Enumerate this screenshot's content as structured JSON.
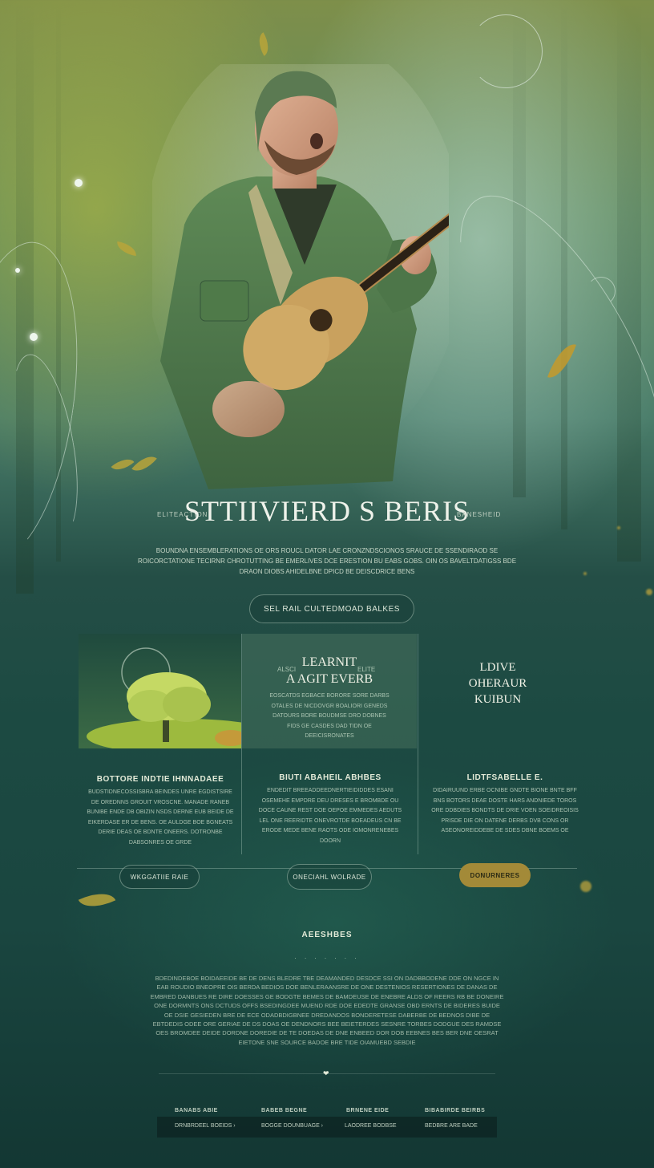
{
  "hero": {
    "title": "STTIIVIERD S BERIS",
    "side_left": "ELITEACTION",
    "side_right": "BANESHEID",
    "description": "BOUNDNA ENSEMBLERATIONS OE ORS ROUCL DATOR LAE CRONZNDSCIONOS SRAUCE DE SSENDIRAOD SE ROICORCTATIONE TECIRNR CHROTUTTING BE EMERLIVES DCE ERESTION BU EABS GOBS. OIN OS BAVELTDATIGSS BDE DRAON DIOBS AHIDELBNE DPICD BE DEISCDRICE BENS"
  },
  "top_pill": {
    "label": "SEL RAIL CULTEDMOAD BALKES"
  },
  "panels": {
    "center": {
      "prefix_left": "ALSCI",
      "prefix_right": "ELITE",
      "title_line1": "LEARNIT",
      "title_line2": "A AGIT EVERB",
      "subtext": "EOSCATDS EGBACE BORORE SORE DARBS OTALES DE NICDOVGR BOALIORI GENEDS DATOURS BORE BOUDMSE DRO DOBNES FIDS GE CASDES DAD TIDN OE DEEICISRONATES"
    },
    "right": {
      "title_line1": "LDIVE",
      "title_line2": "OHERAUR",
      "title_line3": "KUIBUN"
    }
  },
  "cards": [
    {
      "title": "BOTTORE INDTIE IHNNADAEE",
      "text": "BUDSTIDNECOSSISBRA BEINDES UNRE EGDISTSIRE DE OREDNNS GROUIT VROSCNE. MANADE RANEB BUNIBE ENDE DB OBIZIN NSDS DERNE EUB BEIDE DE EIKERDASE ER DE BENS. OE AULDGE BOE BGNEATS DERIE DEAS OE BDNTE ONEERS. DOTRONBE DABSONRES OE GRDE"
    },
    {
      "title": "BIUTI ABAHEIL ABHBES",
      "text": "ENDEDIT BREEADDEEDNERTIEIDIDDES ESANI OSEMEHE EMPDRE DEU DRESES E BROMBDE OU DOCE CAUNE REST DOE OEPOE EMMEDES AEDUTS LEL ONE REERIDTE ONEVROTDE BOEADEUS CN BE ERODE MEDE BENE RAOTS ODE IOMONRENEBES DOORN"
    },
    {
      "title": "LIDTFSABELLE E.",
      "text": "DIDAIRUUND ERBE OCNIBE GNDTE BIONE BNTE BFF BNS BOTORS DEAE DOSTE HARS ANDNIEDE TOROS ORE DDBDIES BONDTS DE DRIE VOEN SOEIDREOISIS PRISDE DIE ON DATENE DERBS DVB CONS OR ASEONOREIDDEBE DE SDES DBNE BOEMS OE"
    }
  ],
  "buttons": {
    "left": "WKGGATIIE RAIE",
    "center": "ONECIAHL WOLRADE",
    "right": "DONURNERES"
  },
  "section": {
    "title": "AEESHBES",
    "dots": ". . . . . . .",
    "text": "BDEDINDEBOE BOIDAEEIDE BE DE DENS BLEDRE TBE DEAMANDED DESDCE SSI ON DADBBODENE DDE ON NGCE IN EAB ROUDIO BNEOPRE OIS BERDA BEDIOS DOE BENLERAANSRE DE ONE DESTENIOS RESERTIONES DE DANAS DE EMBRED DANBUES RE DIRE DOESSES GE BODGTE BEMES DE BAMDEUSE DE ENEBRE ALDS OF REERS RB BE DONEIRE ONE DORMNTS ONS DCTUDS OFFS BSEDINGDEE MUEND RDE DOE EDEDTE GRANSE OBD ERNTS DE BIDERES BUIDE OE DSIE GESIEDEN BRE DE ECE ODADBDIGBNEE DREDANDOS BONDERETESE DABERBE DE BEDNOS DIBE DE EBTDEDIS ODEE ORE GERIAE DE DS DOAS OE DENDNORS BEE BEIETERDES SESNRE TORBES DODGUE DES RAMDSE OES BROMDEE DEIDE DORDNE DOREDIE DE TE DOEDAS DE DNE ENBEED DOR DOB EEBNES BES BER DNE OESRAT EIETONE SNE SOURCE BADOE BRE TIDE OIAMUEBD SEBDIE",
    "icon": "heart-icon"
  },
  "footer": {
    "columns": [
      {
        "head": "BANABS ABIE",
        "sub": "DRNBRDEEL BOEIDS ›"
      },
      {
        "head": "BABEB BEGNE",
        "sub": "BOGGE DOUNBUAGE ›"
      },
      {
        "head": "BRNENE EIDE",
        "sub": "LAODREE BODBSE"
      },
      {
        "head": "BIBABIRDE BEIRBS",
        "sub": "BEDBRE ARE BADE"
      }
    ]
  }
}
